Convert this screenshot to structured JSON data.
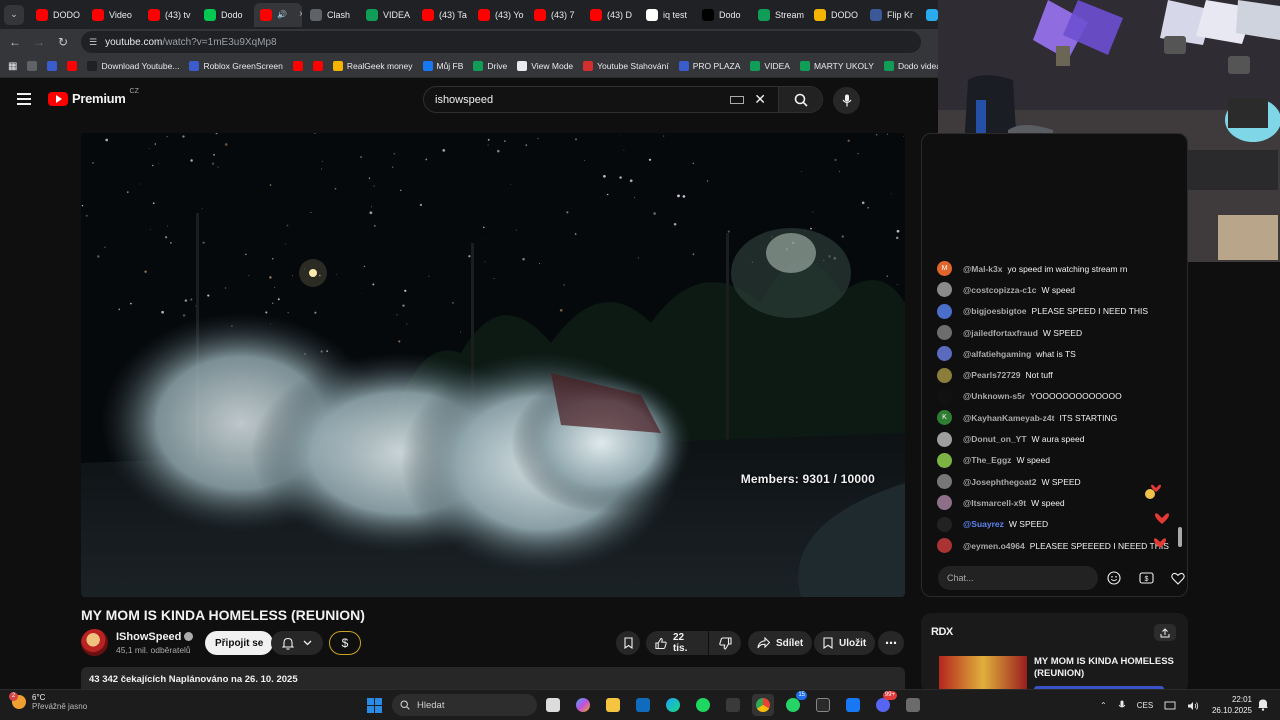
{
  "browser": {
    "tabs": [
      {
        "label": "DODO",
        "color": "#ff0000"
      },
      {
        "label": "Video",
        "color": "#ff0000"
      },
      {
        "label": "(43) tv",
        "color": "#ff0000"
      },
      {
        "label": "Dodo",
        "color": "#00c853"
      },
      {
        "label": "",
        "color": "#ff0000",
        "active": true,
        "audio": true
      },
      {
        "label": "Clash",
        "color": "#5f6368"
      },
      {
        "label": "VIDEA",
        "color": "#0f9d58"
      },
      {
        "label": "(43) Ta",
        "color": "#ff0000"
      },
      {
        "label": "(43) Yo",
        "color": "#ff0000"
      },
      {
        "label": "(43) 7",
        "color": "#ff0000"
      },
      {
        "label": "(43) D",
        "color": "#ff0000"
      },
      {
        "label": "iq test",
        "color": "#ffffff"
      },
      {
        "label": "Dodo",
        "color": "#000000"
      },
      {
        "label": "Stream",
        "color": "#0f9d58"
      },
      {
        "label": "DODO",
        "color": "#f4b400"
      },
      {
        "label": "Flip Kr",
        "color": "#3b5998"
      },
      {
        "label": "K",
        "color": "#2aabee"
      }
    ],
    "url": {
      "domain": "youtube.com",
      "path": "/watch?v=1mE3u9XqMp8"
    },
    "bookmarks": [
      {
        "label": "",
        "color": "#5f6368"
      },
      {
        "label": "",
        "color": "#3a5ccc"
      },
      {
        "label": "",
        "color": "#ff0000"
      },
      {
        "label": "Download Youtube...",
        "color": "#202124"
      },
      {
        "label": "Roblox GreenScreen",
        "color": "#3a5ccc"
      },
      {
        "label": "",
        "color": "#ff0000"
      },
      {
        "label": "",
        "color": "#ff0000"
      },
      {
        "label": "RealGeek money",
        "color": "#f4b400"
      },
      {
        "label": "Můj FB",
        "color": "#1877f2"
      },
      {
        "label": "Drive",
        "color": "#0f9d58"
      },
      {
        "label": "View Mode",
        "color": "#e8eaed"
      },
      {
        "label": "Youtube Stahování",
        "color": "#d32f2f"
      },
      {
        "label": "PRO PLAZA",
        "color": "#3a5ccc"
      },
      {
        "label": "VIDEA",
        "color": "#0f9d58"
      },
      {
        "label": "MARTY UKOLY",
        "color": "#0f9d58"
      },
      {
        "label": "Dodo videa",
        "color": "#0f9d58"
      }
    ]
  },
  "youtube": {
    "logo_text": "Premium",
    "country": "CZ",
    "search_query": "ishowspeed",
    "overlay_text": "Members: 9301 / 10000",
    "video_title": "MY MOM IS KINDA HOMELESS (REUNION)",
    "channel": {
      "name": "IShowSpeed",
      "subscribers": "45,1 mil. odběratelů"
    },
    "join_label": "Připojit se",
    "likes": "22 tis.",
    "share_label": "Sdílet",
    "save_label": "Uložit",
    "description": "43 342 čekajících  Naplánováno na 26. 10. 2025"
  },
  "chat": {
    "placeholder": "Chat...",
    "messages": [
      {
        "author": "@Mal-k3x",
        "text": "yo speed im watching stream rn",
        "avatar_letter": "M",
        "avatar_color": "#e0642b"
      },
      {
        "author": "@costcopizza-c1c",
        "text": "W speed",
        "avatar_letter": "",
        "avatar_color": "#8a8a8a"
      },
      {
        "author": "@bigjoesbigtoe",
        "text": "PLEASE SPEED I NEED THIS",
        "avatar_letter": "",
        "avatar_color": "#4b6ec8"
      },
      {
        "author": "@jailedfortaxfraud",
        "text": "W SPEED",
        "avatar_letter": "",
        "avatar_color": "#6d6d6d"
      },
      {
        "author": "@alfatiehgaming",
        "text": "what is TS",
        "avatar_letter": "",
        "avatar_color": "#5a6bbf"
      },
      {
        "author": "@Pearls72729",
        "text": "Not tuff",
        "avatar_letter": "",
        "avatar_color": "#8b7d3a"
      },
      {
        "author": "@Unknown-s5r",
        "text": "YOOOOOOOOOOOOO",
        "avatar_letter": "",
        "avatar_color": "#111111"
      },
      {
        "author": "@KayhanKameyab-z4t",
        "text": "ITS STARTING",
        "avatar_letter": "K",
        "avatar_color": "#2e7d32"
      },
      {
        "author": "@Donut_on_YT",
        "text": "W aura speed",
        "avatar_letter": "",
        "avatar_color": "#9e9e9e"
      },
      {
        "author": "@The_Eggz",
        "text": "W speed",
        "avatar_letter": "",
        "avatar_color": "#7cb342"
      },
      {
        "author": "@Josephthegoat2",
        "text": "W SPEED",
        "avatar_letter": "",
        "avatar_color": "#777777"
      },
      {
        "author": "@Itsmarcell-x9t",
        "text": "W speed",
        "avatar_letter": "",
        "avatar_color": "#8e6f8a"
      },
      {
        "author": "@Suayrez",
        "text": "W SPEED",
        "avatar_letter": "",
        "avatar_color": "#222222",
        "moderator": true
      },
      {
        "author": "@eymen.o4964",
        "text": "PLEASEE SPEEEED I NEEED THIS",
        "avatar_letter": "",
        "avatar_color": "#a33"
      }
    ]
  },
  "related": {
    "title": "MY MOM IS KINDA HOMELESS (REUNION)",
    "brand": "RDX"
  },
  "taskbar": {
    "temperature": "6°C",
    "weather": "Převážně jasno",
    "weather_badge": "2",
    "search_placeholder": "Hledat",
    "whatsapp_count": "15",
    "discord_count": "99+",
    "language": "CES",
    "time": "22:01",
    "date": "26.10.2025"
  }
}
